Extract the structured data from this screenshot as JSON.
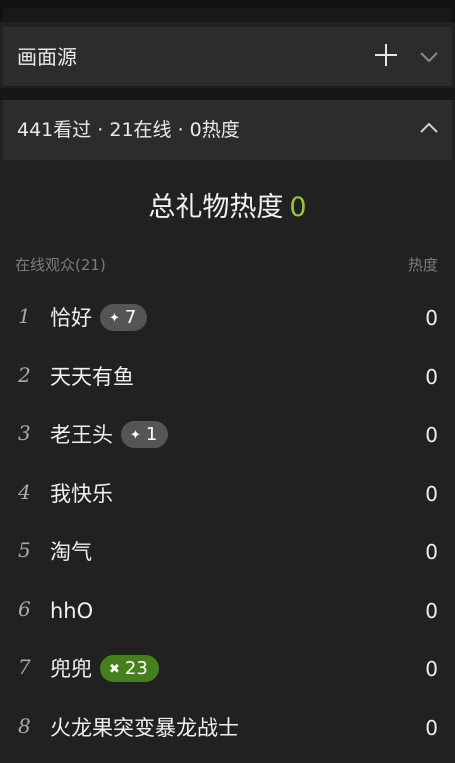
{
  "source_panel": {
    "title": "画面源"
  },
  "stats_panel": {
    "title": "441看过 · 21在线 · 0热度"
  },
  "gift": {
    "label": "总礼物热度",
    "value": "0"
  },
  "audience": {
    "header_left": "在线观众(21)",
    "header_right": "热度",
    "rows": [
      {
        "rank": "1",
        "name": "恰好",
        "badge": "7",
        "badge_icon": "✦",
        "badge_style": "gray",
        "heat": "0"
      },
      {
        "rank": "2",
        "name": "天天有鱼",
        "badge": "",
        "badge_icon": "",
        "badge_style": "",
        "heat": "0"
      },
      {
        "rank": "3",
        "name": "老王头",
        "badge": "1",
        "badge_icon": "✦",
        "badge_style": "gray",
        "heat": "0"
      },
      {
        "rank": "4",
        "name": "我快乐",
        "badge": "",
        "badge_icon": "",
        "badge_style": "",
        "heat": "0"
      },
      {
        "rank": "5",
        "name": "淘气",
        "badge": "",
        "badge_icon": "",
        "badge_style": "",
        "heat": "0"
      },
      {
        "rank": "6",
        "name": "hhO",
        "badge": "",
        "badge_icon": "",
        "badge_style": "",
        "heat": "0"
      },
      {
        "rank": "7",
        "name": "兜兜",
        "badge": "23",
        "badge_icon": "✖",
        "badge_style": "green",
        "heat": "0"
      },
      {
        "rank": "8",
        "name": "火龙果突变暴龙战士",
        "badge": "",
        "badge_icon": "",
        "badge_style": "",
        "heat": "0"
      }
    ]
  },
  "colors": {
    "accent_green": "#8ec63f",
    "badge_gray": "#555555",
    "badge_green": "#44801c",
    "background": "#212121"
  },
  "icons": {
    "add": "plus-icon",
    "collapse": "chevron-up-icon",
    "expand": "chevron-down-icon"
  }
}
